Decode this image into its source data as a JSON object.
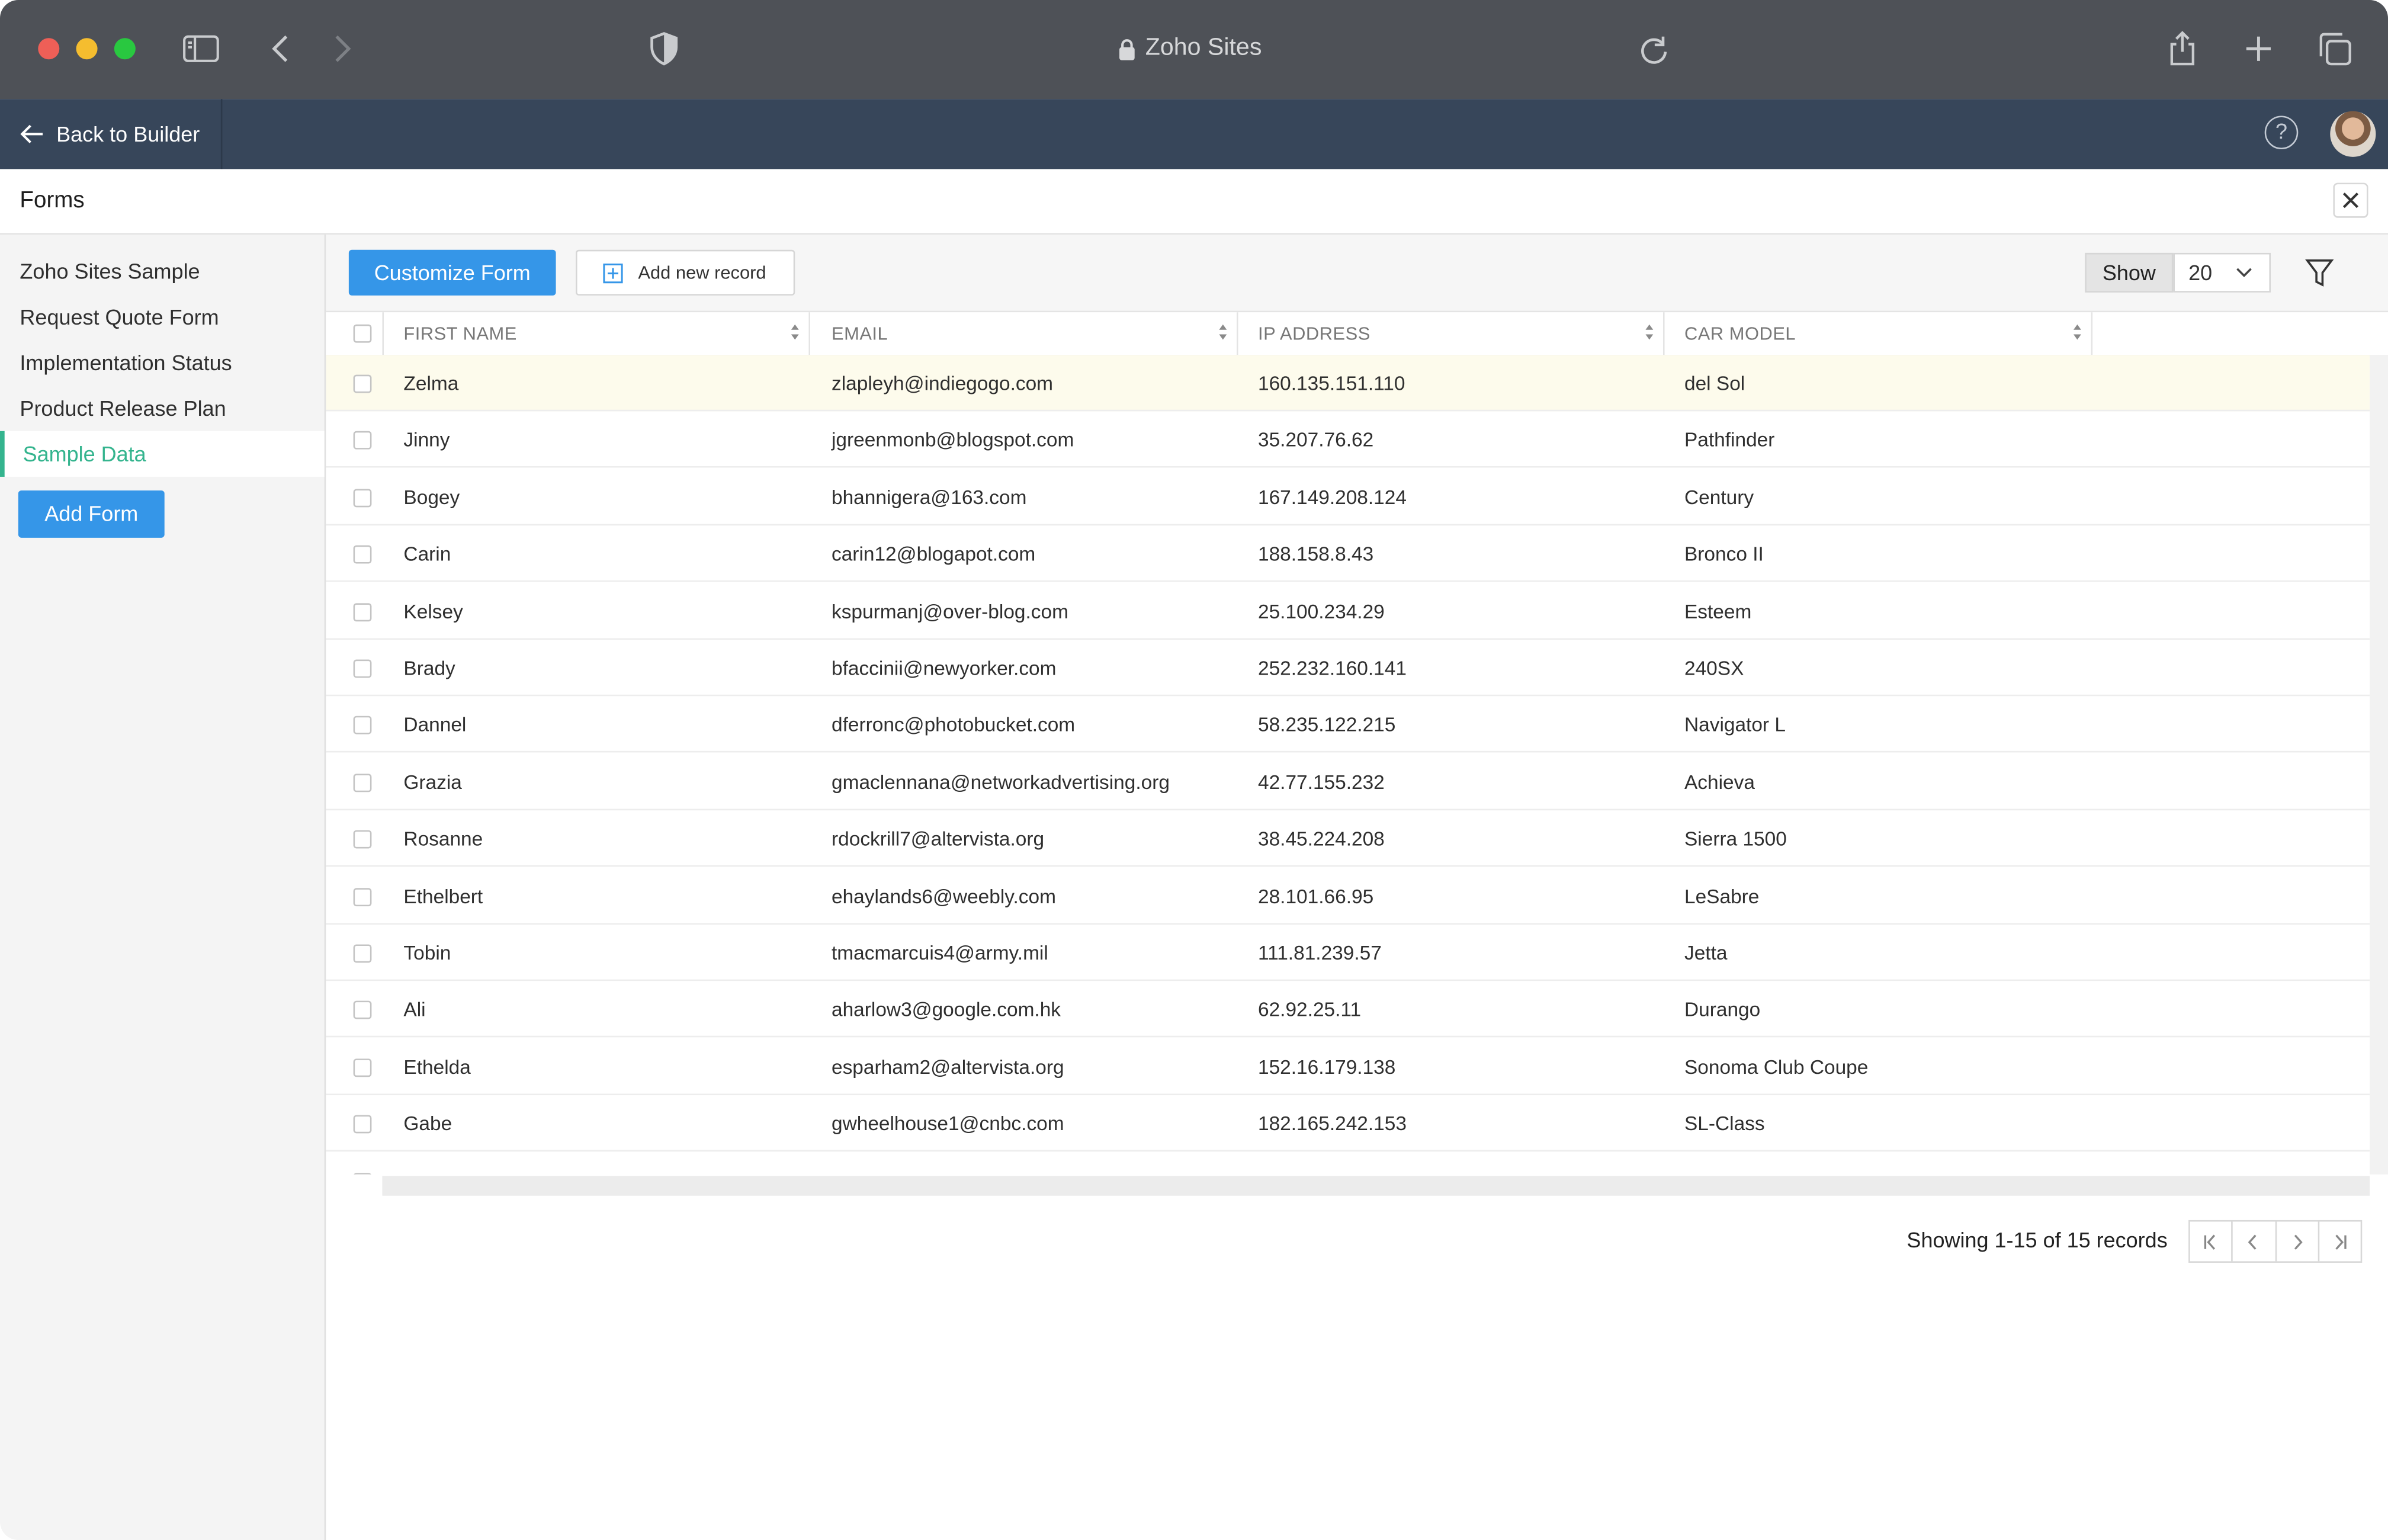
{
  "browser": {
    "url_text": "Zoho Sites"
  },
  "header": {
    "back_label": "Back to Builder",
    "help_glyph": "?"
  },
  "panel": {
    "title": "Forms"
  },
  "sidebar": {
    "items": [
      {
        "label": "Zoho Sites Sample",
        "active": false
      },
      {
        "label": "Request Quote Form",
        "active": false
      },
      {
        "label": "Implementation Status",
        "active": false
      },
      {
        "label": "Product Release Plan",
        "active": false
      },
      {
        "label": "Sample Data",
        "active": true
      }
    ],
    "add_form_label": "Add Form"
  },
  "toolbar": {
    "customize_label": "Customize Form",
    "add_record_label": "Add new record",
    "show_label": "Show",
    "show_value": "20"
  },
  "table": {
    "columns": [
      "FIRST NAME",
      "EMAIL",
      "IP ADDRESS",
      "CAR MODEL"
    ],
    "rows": [
      [
        "Zelma",
        "zlapleyh@indiegogo.com",
        "160.135.151.110",
        "del Sol"
      ],
      [
        "Jinny",
        "jgreenmonb@blogspot.com",
        "35.207.76.62",
        "Pathfinder"
      ],
      [
        "Bogey",
        "bhannigera@163.com",
        "167.149.208.124",
        "Century"
      ],
      [
        "Carin",
        "carin12@blogapot.com",
        "188.158.8.43",
        "Bronco II"
      ],
      [
        "Kelsey",
        "kspurmanj@over-blog.com",
        "25.100.234.29",
        "Esteem"
      ],
      [
        "Brady",
        "bfaccinii@newyorker.com",
        "252.232.160.141",
        "240SX"
      ],
      [
        "Dannel",
        "dferronc@photobucket.com",
        "58.235.122.215",
        "Navigator L"
      ],
      [
        "Grazia",
        "gmaclennana@networkadvertising.org",
        "42.77.155.232",
        "Achieva"
      ],
      [
        "Rosanne",
        "rdockrill7@altervista.org",
        "38.45.224.208",
        "Sierra 1500"
      ],
      [
        "Ethelbert",
        "ehaylands6@weebly.com",
        "28.101.66.95",
        "LeSabre"
      ],
      [
        "Tobin",
        "tmacmarcuis4@army.mil",
        "111.81.239.57",
        "Jetta"
      ],
      [
        "Ali",
        "aharlow3@google.com.hk",
        "62.92.25.11",
        "Durango"
      ],
      [
        "Ethelda",
        "esparham2@altervista.org",
        "152.16.179.138",
        "Sonoma Club Coupe"
      ],
      [
        "Gabe",
        "gwheelhouse1@cnbc.com",
        "182.165.242.153",
        "SL-Class"
      ]
    ],
    "highlight_color": "#fdfbec"
  },
  "footer": {
    "records_text": "Showing 1-15 of 15 records"
  },
  "colors": {
    "accent_blue": "#3596e8",
    "active_green": "#34b48e",
    "header_bg": "#37465a",
    "chrome_bg": "#4e5157"
  }
}
